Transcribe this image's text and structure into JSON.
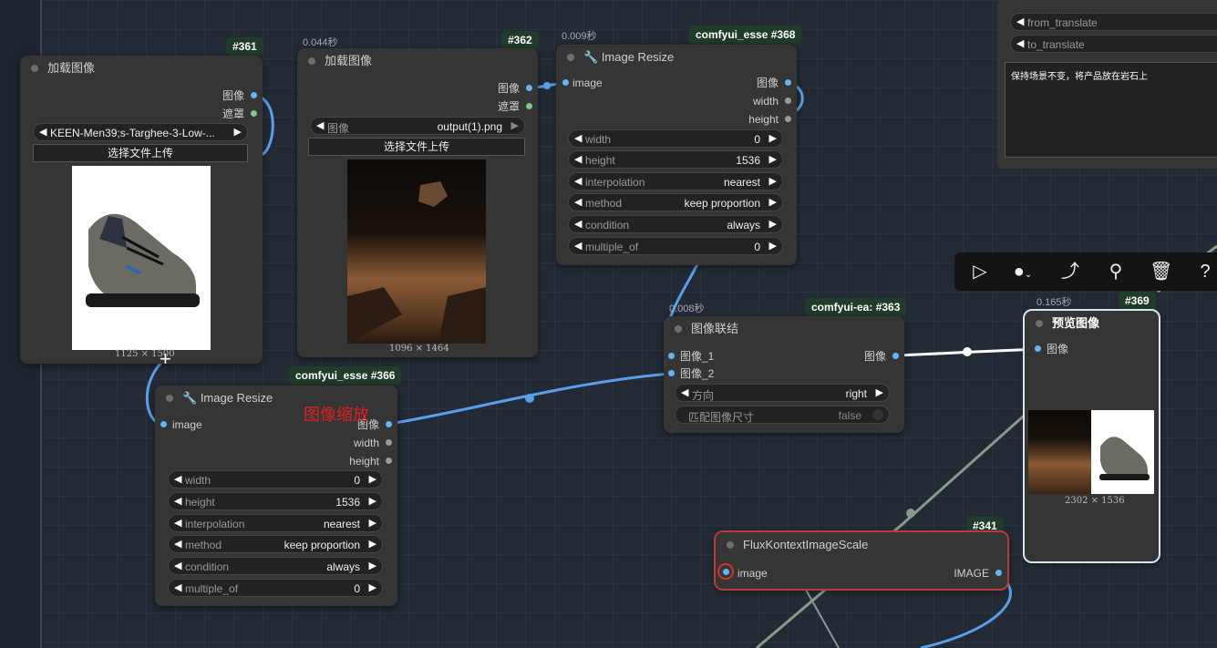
{
  "nodes": {
    "n361": {
      "id": "#361",
      "title": "加载图像",
      "outputs": [
        "图像",
        "遮罩"
      ],
      "file_value": "KEEN-Men39;s-Targhee-3-Low-...",
      "upload_label": "选择文件上传",
      "image_size": "1125 × 1500"
    },
    "n362": {
      "id": "#362",
      "timing": "0.044秒",
      "title": "加载图像",
      "outputs": [
        "图像",
        "遮罩"
      ],
      "file_label": "图像",
      "file_value": "output(1).png",
      "upload_label": "选择文件上传",
      "image_size": "1096 × 1464"
    },
    "n368": {
      "id": "#368",
      "group": "comfyui_esse",
      "timing": "0.009秒",
      "title": "Image Resize",
      "input": "image",
      "outputs": [
        "图像",
        "width",
        "height"
      ],
      "widgets": [
        {
          "label": "width",
          "value": "0"
        },
        {
          "label": "height",
          "value": "1536"
        },
        {
          "label": "interpolation",
          "value": "nearest"
        },
        {
          "label": "method",
          "value": "keep proportion"
        },
        {
          "label": "condition",
          "value": "always"
        },
        {
          "label": "multiple_of",
          "value": "0"
        }
      ]
    },
    "n366": {
      "id": "#366",
      "group": "comfyui_esse",
      "title": "Image Resize",
      "input": "image",
      "outputs": [
        "图像",
        "width",
        "height"
      ],
      "widgets": [
        {
          "label": "width",
          "value": "0"
        },
        {
          "label": "height",
          "value": "1536"
        },
        {
          "label": "interpolation",
          "value": "nearest"
        },
        {
          "label": "method",
          "value": "keep proportion"
        },
        {
          "label": "condition",
          "value": "always"
        },
        {
          "label": "multiple_of",
          "value": "0"
        }
      ]
    },
    "n363": {
      "id": "#363",
      "group": "comfyui-ea:",
      "timing": "0.008秒",
      "title": "图像联结",
      "inputs": [
        "图像_1",
        "图像_2"
      ],
      "output": "图像",
      "widgets": [
        {
          "label": "方向",
          "value": "right"
        },
        {
          "label": "匹配图像尺寸",
          "value": "false"
        }
      ]
    },
    "n369": {
      "id": "#369",
      "timing": "0.165秒",
      "title": "预览图像",
      "input": "图像",
      "image_size": "2302 × 1536"
    },
    "n341": {
      "id": "#341",
      "title": "FluxKontextImageScale",
      "input": "image",
      "output": "IMAGE"
    }
  },
  "translate_node": {
    "from_label": "from_translate",
    "to_label": "to_translate",
    "text": "保持场景不变，将产品放在岩石上"
  },
  "annotation": "图像缩放",
  "toolbar": {
    "icons": [
      "play-icon",
      "color-circle-icon",
      "bypass-icon",
      "pin-icon",
      "trash-icon",
      "help-icon"
    ]
  },
  "colors": {
    "link": "#5aa0e8",
    "badge_bg": "#1f3d2a",
    "node_bg": "#353535",
    "canvas_bg": "#222a36",
    "annotation": "#e02020"
  }
}
